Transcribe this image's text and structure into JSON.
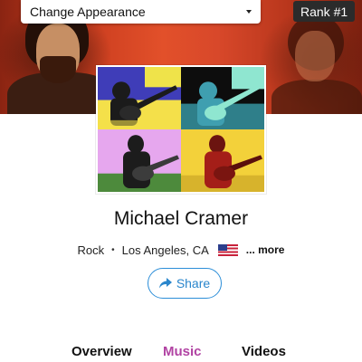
{
  "header": {
    "appearance_select": {
      "label": "Change Appearance"
    },
    "rank_badge": "Rank #1"
  },
  "colors": {
    "accent_blue": "#2c8ed8",
    "tab_active": "#b143a3",
    "banner_red": "#d8482a"
  },
  "profile": {
    "name": "Michael Cramer",
    "genre": "Rock",
    "location": "Los Angeles, CA",
    "country_flag_icon": "us-flag-icon",
    "more_label": "... more",
    "share_label": "Share",
    "share_icon": "share-arrow-icon"
  },
  "tabs": [
    {
      "label": "Overview",
      "active": false
    },
    {
      "label": "Music",
      "active": true
    },
    {
      "label": "Videos",
      "active": false
    }
  ]
}
